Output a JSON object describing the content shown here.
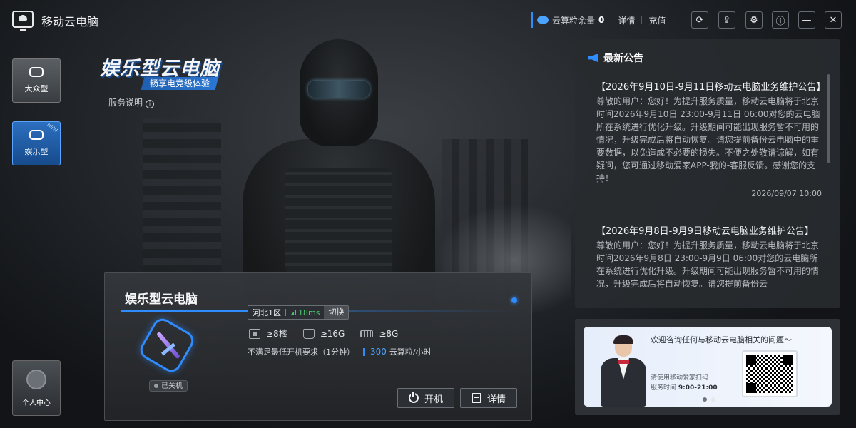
{
  "app": {
    "title": "移动云电脑"
  },
  "titlebar": {
    "credit_label": "云算粒余量",
    "credit_count": "0",
    "detail_link": "详情",
    "recharge_link": "充值",
    "buttons": [
      "refresh-icon",
      "share-icon",
      "settings-icon",
      "info-icon",
      "minimize-icon",
      "close-icon"
    ]
  },
  "sidebar": {
    "tabs": [
      {
        "label": "大众型",
        "icon": "cloud-monitor-icon"
      },
      {
        "label": "娱乐型",
        "icon": "gamepad-icon",
        "badge": "NEW"
      }
    ],
    "profile_label": "个人中心"
  },
  "hero": {
    "title": "娱乐型云电脑",
    "subtitle": "畅享电竞级体验",
    "service_link": "服务说明"
  },
  "notices": {
    "header": "最新公告",
    "items": [
      {
        "title": "【2026年9月10日-9月11日移动云电脑业务维护公告】",
        "body": "尊敬的用户：您好！为提升服务质量，移动云电脑将于北京时间2026年9月10日 23:00-9月11日 06:00对您的云电脑所在系统进行优化升级。升级期间可能出现服务暂不可用的情况，升级完成后将自动恢复。请您提前备份云电脑中的重要数据，以免造成不必要的损失。不便之处敬请谅解，如有疑问，您可通过移动爱家APP-我的-客服反馈。感谢您的支持！",
        "date": "2026/09/07 10:00"
      },
      {
        "title": "【2026年9月8日-9月9日移动云电脑业务维护公告】",
        "body": "尊敬的用户：您好！为提升服务质量，移动云电脑将于北京时间2026年9月8日 23:00-9月9日 06:00对您的云电脑所在系统进行优化升级。升级期间可能出现服务暂不可用的情况，升级完成后将自动恢复。请您提前备份云",
        "date": ""
      }
    ]
  },
  "service": {
    "title": "欢迎咨询任何与移动云电脑相关的问题～",
    "scan_hint": "请使用移动爱家扫码",
    "hours_label": "服务时间",
    "hours": "9:00-21:00"
  },
  "pc": {
    "name": "娱乐型云电脑",
    "region": "河北1区",
    "latency": "18ms",
    "switch_label": "切换",
    "cpu": "≥8核",
    "disk": "≥16G",
    "ram": "≥8G",
    "requirement": "不满足最低开机要求（1分钟）",
    "price_value": "300",
    "price_unit": "云算粒/小时",
    "status": "已关机",
    "start_label": "开机",
    "detail_label": "详情"
  },
  "colors": {
    "accent": "#2f8cff",
    "latency": "#45c86b"
  }
}
